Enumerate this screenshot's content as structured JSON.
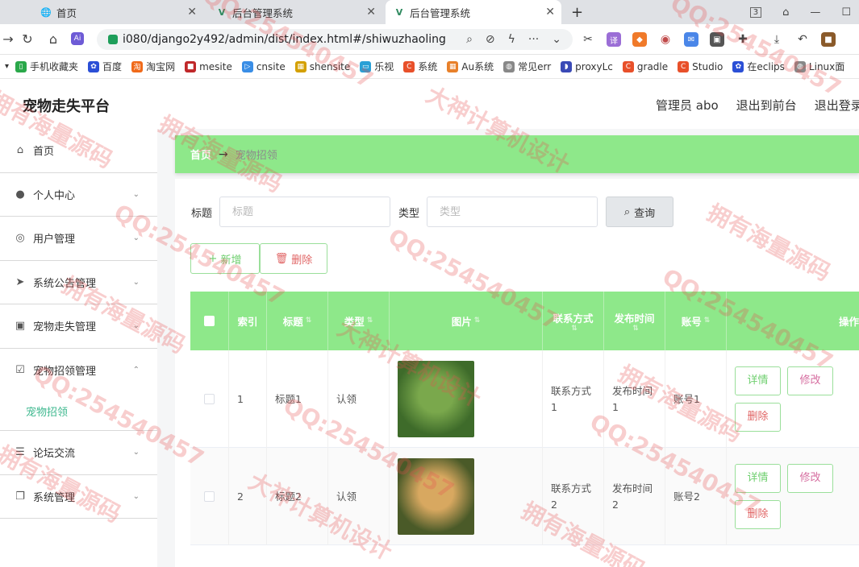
{
  "browser": {
    "tabs": [
      {
        "label": "首页",
        "active": false
      },
      {
        "label": "后台管理系统",
        "active": false
      },
      {
        "label": "后台管理系统",
        "active": true
      }
    ],
    "tab_count": "3",
    "url": "i080/django2y492/admin/dist/index.html#/shiwuzhaoling",
    "bookmarks": [
      "手机收藏夹",
      "百度",
      "淘宝网",
      "mesite",
      "cnsite",
      "shensite",
      "乐视",
      "系统",
      "Au系统",
      "常见err",
      "proxyLc",
      "gradle",
      "Studio",
      "在eclips",
      "Linux面"
    ]
  },
  "header": {
    "title": "宠物走失平台",
    "user": "管理员 abo",
    "to_front": "退出到前台",
    "logout": "退出登录"
  },
  "sidebar": {
    "items": [
      {
        "label": "首页",
        "icon": "home-icon",
        "arrow": ""
      },
      {
        "label": "个人中心",
        "icon": "user-icon",
        "arrow": "v"
      },
      {
        "label": "用户管理",
        "icon": "users-icon",
        "arrow": "v"
      },
      {
        "label": "系统公告管理",
        "icon": "send-icon",
        "arrow": "v"
      },
      {
        "label": "宠物走失管理",
        "icon": "clipboard-icon",
        "arrow": "v"
      },
      {
        "label": "宠物招领管理",
        "icon": "checkbox-icon",
        "arrow": "^"
      },
      {
        "label": "论坛交流",
        "icon": "sliders-icon",
        "arrow": "v"
      },
      {
        "label": "系统管理",
        "icon": "copy-icon",
        "arrow": "v"
      }
    ],
    "sub_active": "宠物招领"
  },
  "breadcrumb": {
    "home": "首页",
    "sep": "→",
    "current": "宠物招领"
  },
  "search": {
    "title_label": "标题",
    "title_placeholder": "标题",
    "type_label": "类型",
    "type_placeholder": "类型",
    "query_label": "查询"
  },
  "actions": {
    "add_label": "新增",
    "delete_label": "删除"
  },
  "table": {
    "columns": [
      "索引",
      "标题",
      "类型",
      "图片",
      "联系方式",
      "发布时间",
      "账号",
      "操作"
    ],
    "rows": [
      {
        "index": "1",
        "title": "标题1",
        "type": "认领",
        "contact": "联系方式1",
        "time": "发布时间1",
        "account": "账号1",
        "pic_colors": [
          "#3e6b2a",
          "#7aa84c"
        ]
      },
      {
        "index": "2",
        "title": "标题2",
        "type": "认领",
        "contact": "联系方式2",
        "time": "发布时间2",
        "account": "账号2",
        "pic_colors": [
          "#4a5a28",
          "#d8a860"
        ]
      }
    ],
    "op_detail": "详情",
    "op_edit": "修改",
    "op_delete": "删除"
  },
  "watermark": [
    "拥有海量源码",
    "QQ:254540457",
    "大神计算机设计"
  ],
  "colors": {
    "accent": "#8ee88a",
    "active_sub": "#3fb88f",
    "danger": "#e06464"
  }
}
